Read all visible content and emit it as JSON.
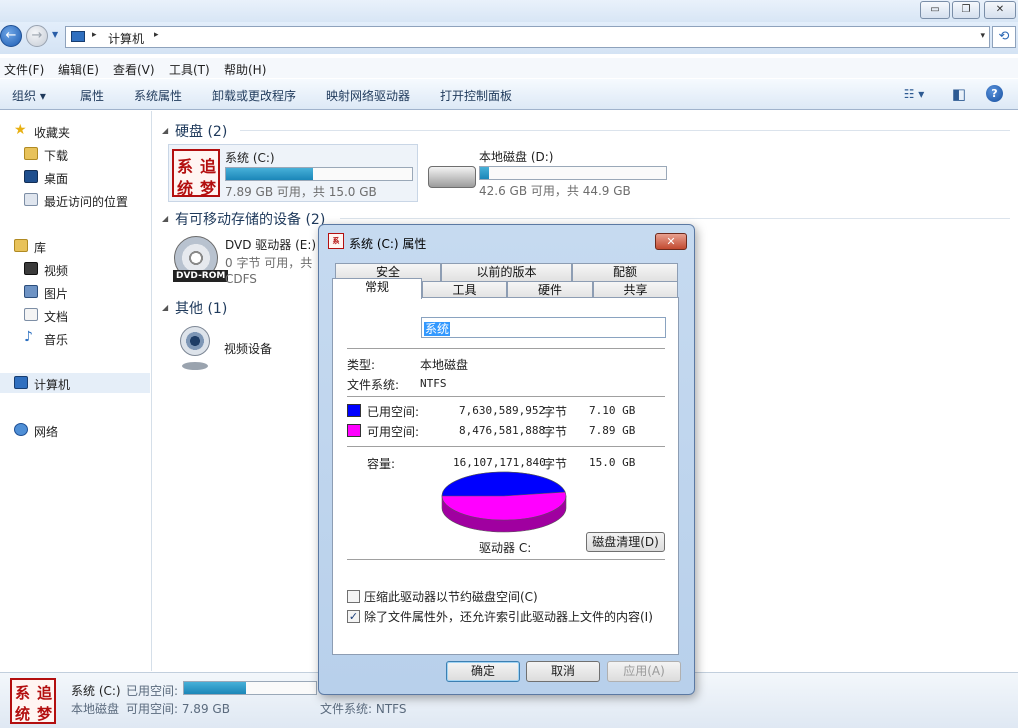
{
  "window": {
    "min": "▭",
    "max": "❐",
    "close": "✕"
  },
  "address": {
    "crumb": "计算机",
    "arrow": "▸",
    "dropdown": "▾",
    "refresh": "⟲"
  },
  "menu": [
    "文件(F)",
    "编辑(E)",
    "查看(V)",
    "工具(T)",
    "帮助(H)"
  ],
  "toolbar": {
    "organize": "组织 ▾",
    "items": [
      "属性",
      "系统属性",
      "卸载或更改程序",
      "映射网络驱动器",
      "打开控制面板"
    ],
    "view": "☷ ▾",
    "pane": "◧",
    "help": "?"
  },
  "nav": {
    "favorites": "收藏夹",
    "downloads": "下载",
    "desktop": "桌面",
    "recent": "最近访问的位置",
    "libraries": "库",
    "videos": "视频",
    "pictures": "图片",
    "documents": "文档",
    "music": "音乐",
    "computer": "计算机",
    "network": "网络"
  },
  "groups": {
    "hdd": "硬盘 (2)",
    "removable": "有可移动存储的设备 (2)",
    "other": "其他 (1)"
  },
  "drives": {
    "c": {
      "name": "系统 (C:)",
      "sub": "7.89 GB 可用，共 15.0 GB",
      "used_fraction": 0.47
    },
    "d": {
      "name": "本地磁盘 (D:)",
      "sub": "42.6 GB 可用，共 44.9 GB",
      "used_fraction": 0.05
    },
    "dvd": {
      "name": "DVD 驱动器 (E:)",
      "sub": "0 字节 可用，共",
      "fs": "CDFS",
      "tag": "DVD-ROM"
    },
    "video": {
      "name": "视频设备"
    }
  },
  "logo": {
    "c1": "系",
    "c2": "追",
    "c3": "统",
    "c4": "梦"
  },
  "status": {
    "name": "系统 (C:)",
    "used_label": "已用空间:",
    "type": "本地磁盘",
    "free": "可用空间: 7.89 GB",
    "fs": "文件系统: NTFS",
    "used_fraction": 0.47
  },
  "dialog": {
    "title": "系统 (C:) 属性",
    "close": "✕",
    "tabs_top": [
      "安全",
      "以前的版本",
      "配额"
    ],
    "tabs_bottom": [
      "常规",
      "工具",
      "硬件",
      "共享"
    ],
    "name_value": "系统",
    "type_label": "类型:",
    "type_value": "本地磁盘",
    "fs_label": "文件系统:",
    "fs_value": "NTFS",
    "used_label": "已用空间:",
    "used_bytes": "7,630,589,952",
    "used_gb": "7.10 GB",
    "free_label": "可用空间:",
    "free_bytes": "8,476,581,888",
    "free_gb": "7.89 GB",
    "cap_label": "容量:",
    "cap_bytes": "16,107,171,840",
    "cap_gb": "15.0 GB",
    "bytes_unit": "字节",
    "drive_label": "驱动器 C:",
    "cleanup": "磁盘清理(D)",
    "compress": "压缩此驱动器以节约磁盘空间(C)",
    "index": "除了文件属性外，还允许索引此驱动器上文件的内容(I)",
    "ok": "确定",
    "cancel": "取消",
    "apply": "应用(A)",
    "colors": {
      "used": "#0000ff",
      "free": "#ff00ff"
    },
    "compress_checked": false,
    "index_checked": true
  }
}
